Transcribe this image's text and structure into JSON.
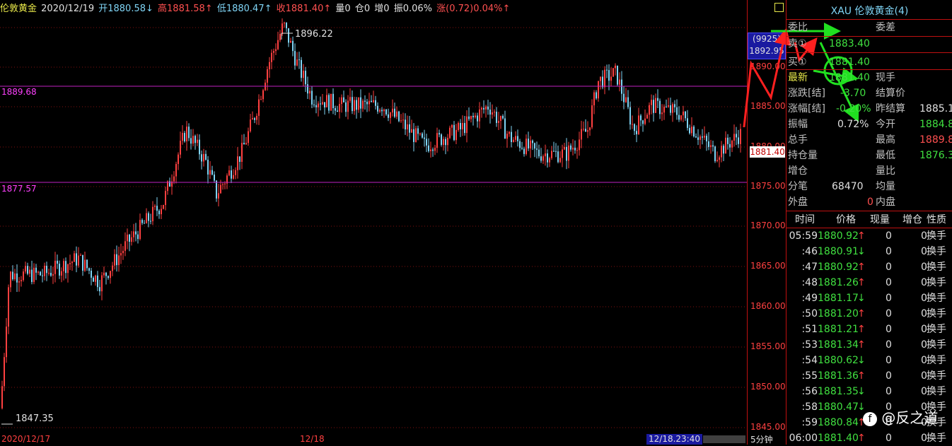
{
  "header": {
    "instrument": "伦敦黄金",
    "date": "2020/12/19",
    "open": "开1880.58↓",
    "high": "高1881.58↑",
    "low": "低1880.47↑",
    "close": "收1881.40↑",
    "volume": "量0",
    "position": "仓0",
    "increase": "增0",
    "amplitude": "振0.06%",
    "change": "涨(0.72)0.04%↑"
  },
  "chart": {
    "level_upper": "1889.68",
    "level_lower": "1877.57",
    "peak_label": "1896.22",
    "low_label": "1847.35",
    "axis_ticks": [
      "1845.00",
      "1850.00",
      "1855.00",
      "1860.00",
      "1865.00",
      "1870.00",
      "1875.00",
      "1880.00",
      "1885.00",
      "1890.00"
    ],
    "axis_top_box": "(9925)",
    "axis_top_value": "1892.95",
    "current_price": "1881.40",
    "x_labels": [
      "2020/12/17",
      "12/18"
    ],
    "cursor_time": "12/18.23:40",
    "period": "5分钟",
    "colors": {
      "level": "#c020c0",
      "grid": "#801010",
      "bar_up": "#ff4040",
      "bar_down": "#7fd4f5"
    }
  },
  "chart_data": {
    "type": "candlestick",
    "y_range": [
      1845,
      1897
    ],
    "levels": [
      1889.68,
      1877.57
    ],
    "peak": 1896.22,
    "low": 1847.35,
    "last": 1881.4
  },
  "quote": {
    "title": "XAU 伦敦黄金(4)",
    "weibi_label": "委比",
    "weicha_label": "委差",
    "sell_label": "卖①",
    "sell_value": "1883.40",
    "buy_label": "买①",
    "buy_value": "1881.40",
    "latest_label": "最新",
    "latest_value": "1881.40",
    "xianshou_label": "现手",
    "zhangdie_label": "涨跌[结]",
    "zhangdie_value": "-3.70",
    "jiesuanjia_label": "结算价",
    "zhangfu_label": "涨幅[结]",
    "zhangfu_value": "-0.20%",
    "zuojiesuan_label": "昨结算",
    "zuojiesuan_value": "1885.1",
    "zhenfu_label": "振幅",
    "zhenfu_value": "0.72%",
    "jinkai_label": "今开",
    "jinkai_value": "1884.8",
    "zongshou_label": "总手",
    "zuigao_label": "最高",
    "zuigao_value": "1889.8",
    "chicang_label": "持仓量",
    "zuidi_label": "最低",
    "zuidi_value": "1876.3",
    "zengcang_label": "增仓",
    "liangbi_label": "量比",
    "fenbi_label": "分笔",
    "fenbi_value": "68470",
    "junliang_label": "均量",
    "waipan_label": "外盘",
    "waipan_value": "0",
    "neipan_label": "内盘"
  },
  "ticks": {
    "headers": [
      "时间",
      "价格",
      "现量",
      "增仓",
      "性质"
    ],
    "rows": [
      {
        "time": "05:59",
        "price": "1880.92",
        "dir": "↑",
        "vol": "0",
        "inc": "0",
        "nature": "换手"
      },
      {
        "time": ":46",
        "price": "1880.91",
        "dir": "↓",
        "vol": "0",
        "inc": "0",
        "nature": "换手"
      },
      {
        "time": ":47",
        "price": "1880.92",
        "dir": "↑",
        "vol": "0",
        "inc": "0",
        "nature": "换手"
      },
      {
        "time": ":48",
        "price": "1881.26",
        "dir": "↑",
        "vol": "0",
        "inc": "0",
        "nature": "换手"
      },
      {
        "time": ":49",
        "price": "1881.17",
        "dir": "↓",
        "vol": "0",
        "inc": "0",
        "nature": "换手"
      },
      {
        "time": ":50",
        "price": "1881.20",
        "dir": "↑",
        "vol": "0",
        "inc": "0",
        "nature": "换手"
      },
      {
        "time": ":51",
        "price": "1881.21",
        "dir": "↑",
        "vol": "0",
        "inc": "0",
        "nature": "换手"
      },
      {
        "time": ":53",
        "price": "1881.34",
        "dir": "↑",
        "vol": "0",
        "inc": "0",
        "nature": "换手"
      },
      {
        "time": ":54",
        "price": "1880.62",
        "dir": "↓",
        "vol": "0",
        "inc": "0",
        "nature": "换手"
      },
      {
        "time": ":55",
        "price": "1881.36",
        "dir": "↑",
        "vol": "0",
        "inc": "0",
        "nature": "换手"
      },
      {
        "time": ":56",
        "price": "1881.35",
        "dir": "↓",
        "vol": "0",
        "inc": "0",
        "nature": "换手"
      },
      {
        "time": ":58",
        "price": "1880.47",
        "dir": "↓",
        "vol": "0",
        "inc": "0",
        "nature": "换手"
      },
      {
        "time": ":59",
        "price": "1880.84",
        "dir": "↑",
        "vol": "0",
        "inc": "0",
        "nature": "换手"
      },
      {
        "time": "06:00",
        "price": "1881.40",
        "dir": "↑",
        "vol": "0",
        "inc": "0",
        "nature": "换手"
      }
    ]
  },
  "watermark": "@反之道"
}
